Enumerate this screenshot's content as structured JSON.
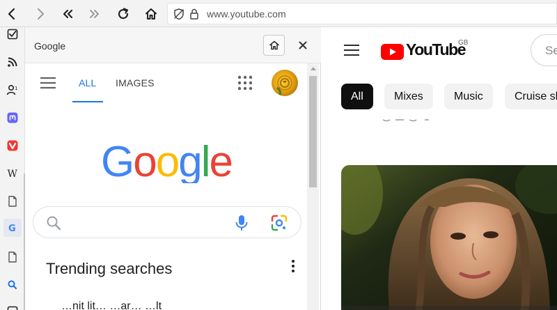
{
  "toolbar": {
    "buttons": [
      "back-icon",
      "forward-icon",
      "rewind-icon",
      "fast-forward-icon",
      "reload-icon",
      "home-icon"
    ],
    "address_bar": {
      "url": "www.youtube.com",
      "icons": [
        "tracker-blocker-icon",
        "lock-icon"
      ]
    }
  },
  "panel_bar": {
    "items": [
      "checklist-icon",
      "feed-icon",
      "contacts-icon",
      "mastodon-icon",
      "vivaldi-icon",
      "wikipedia-icon",
      "page-icon",
      "google-icon",
      "page-icon",
      "search-icon",
      "window-icon"
    ],
    "wikipedia_letter": "W",
    "active_item": "google-icon"
  },
  "side_panel": {
    "title": "Google",
    "google": {
      "tabs": [
        "ALL",
        "IMAGES"
      ],
      "active_tab": "ALL",
      "logo_text": "Google",
      "search": {
        "value": "",
        "placeholder": ""
      },
      "trending_title": "Trending searches",
      "trending_items": [
        "…nit lit…  …ar…  …lt"
      ]
    }
  },
  "youtube": {
    "wordmark": "YouTube",
    "country_code": "GB",
    "search_placeholder": "Se",
    "chips": [
      "All",
      "Mixes",
      "Music",
      "Cruise sh"
    ],
    "active_chip": "All"
  },
  "colors": {
    "accent_blue": "#1a73e8",
    "youtube_red": "#ff0000",
    "chip_active": "#0f0f0f",
    "chip_inactive": "#f2f2f2"
  }
}
